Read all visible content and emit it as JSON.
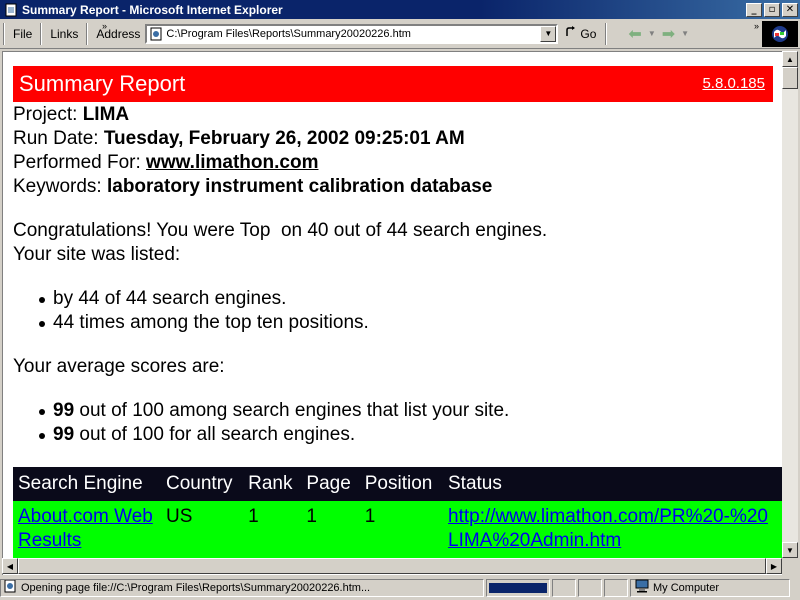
{
  "window": {
    "title": "Summary Report - Microsoft Internet Explorer",
    "minimize": "_",
    "maximize": "▫",
    "close": "✕"
  },
  "toolbar": {
    "file_label": "File",
    "links_label": "Links",
    "address_label": "Address",
    "address_value": "C:\\Program Files\\Reports\\Summary20020226.htm",
    "go_label": "Go",
    "chevron": "»"
  },
  "report": {
    "title": "Summary Report",
    "version": "5.8.0.185",
    "project_label": "Project:",
    "project_value": "LIMA",
    "run_date_label": "Run Date:",
    "run_date_value": "Tuesday, February 26, 2002 09:25:01 AM",
    "performed_for_label": "Performed For:",
    "performed_for_value": "www.limathon.com",
    "keywords_label": "Keywords:",
    "keywords_value": "laboratory instrument calibration database",
    "congrats": "Congratulations! You were Top  on 40 out of 44 search engines.",
    "listed_intro": "Your site was listed:",
    "listed_items": [
      "by 44 of 44 search engines.",
      "44 times among the top ten positions."
    ],
    "average_intro": "Your average scores are:",
    "average_items": [
      {
        "score": "99",
        "text": " out of 100 among search engines that list your site."
      },
      {
        "score": "99",
        "text": " out of 100 for all search engines."
      }
    ]
  },
  "results_table": {
    "columns": [
      "Search Engine",
      "Country",
      "Rank",
      "Page",
      "Position",
      "Status"
    ],
    "rows": [
      {
        "engine": "About.com Web Results",
        "country": "US",
        "rank": "1",
        "page": "1",
        "position": "1",
        "status": "http://www.limathon.com/PR%20-%20LIMA%20Admin.htm"
      }
    ]
  },
  "statusbar": {
    "message": "Opening page file://C:\\Program Files\\Reports\\Summary20020226.htm...",
    "zone": "My Computer"
  }
}
